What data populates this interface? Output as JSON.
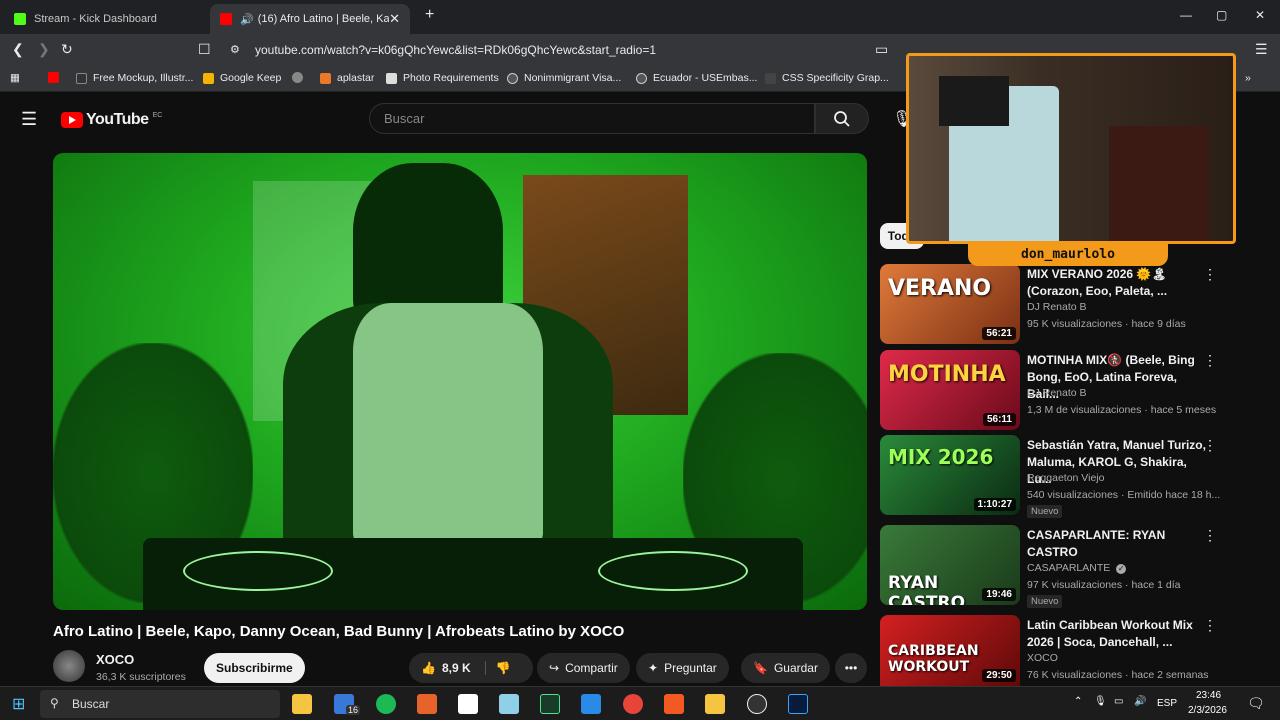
{
  "browser": {
    "tabs": [
      {
        "label": "Stream - Kick Dashboard",
        "favicon_color": "#53fc18"
      },
      {
        "label": "(16) Afro Latino | Beele, Kapo,",
        "favicon_color": "#ff0000"
      }
    ],
    "url": "youtube.com/watch?v=k06gQhcYewc&list=RDk06gQhcYewc&start_radio=1",
    "bookmarks": [
      "Free Mockup, Illustr...",
      "Google Keep",
      "aplastar",
      "Photo Requirements",
      "Nonimmigrant Visa...",
      "Ecuador - USEmbas...",
      "CSS Specificity Grap..."
    ]
  },
  "youtube": {
    "logo": "YouTube",
    "region": "EC",
    "search_placeholder": "Buscar",
    "video_title": "Afro Latino | Beele, Kapo, Danny Ocean, Bad Bunny | Afrobeats Latino by XOCO",
    "channel": {
      "name": "XOCO",
      "subscribers": "36,3 K suscriptores"
    },
    "subscribe_label": "Subscribirme",
    "likes": "8,9 K",
    "share_label": "Compartir",
    "ask_label": "Preguntar",
    "save_label": "Guardar",
    "filter_chip": "Todo",
    "recommendations": [
      {
        "title": "MIX VERANO 2026 🌞🏝 (Corazon, Eoo, Paleta, ...",
        "channel": "DJ Renato B",
        "meta": "95 K visualizaciones · hace 9 días",
        "duration": "56:21",
        "thumb_text": "VERANO",
        "thumb_color": "#c2562a"
      },
      {
        "title": "MOTINHA MIX🚷 (Beele, Bing Bong, EoO, Latina Foreva, Bail...",
        "channel": "DJ Renato B",
        "meta": "1,3 M de visualizaciones · hace 5 meses",
        "duration": "56:11",
        "thumb_text": "MOTINHA",
        "thumb_color": "#c9163a"
      },
      {
        "title": "Sebastián Yatra, Manuel Turizo, Maluma, KAROL G, Shakira, Lu...",
        "channel": "Reggaeton Viejo",
        "meta": "540 visualizaciones · Emitido hace 18 h...",
        "duration": "1:10:27",
        "thumb_text": "MIX 2026",
        "thumb_color": "#1d6b2c",
        "badge": "Nuevo"
      },
      {
        "title": "CASAPARLANTE: RYAN CASTRO",
        "channel": "CASAPARLANTE",
        "meta": "97 K visualizaciones · hace 1 día",
        "duration": "19:46",
        "thumb_text": "RYAN CASTRO",
        "thumb_color": "#2f6a2f",
        "badge": "Nuevo"
      },
      {
        "title": "Latin Caribbean Workout Mix 2026 | Soca, Dancehall, ...",
        "channel": "XOCO",
        "meta": "76 K visualizaciones · hace 2 semanas",
        "duration": "29:50",
        "thumb_text": "CARIBBEAN WORKOUT",
        "thumb_color": "#b11a1a"
      }
    ]
  },
  "overlay": {
    "username": "don_maurlolo"
  },
  "taskbar": {
    "search_label": "Buscar",
    "notification_count": "16",
    "language": "ESP",
    "time": "23:46",
    "date": "2/3/2026"
  }
}
